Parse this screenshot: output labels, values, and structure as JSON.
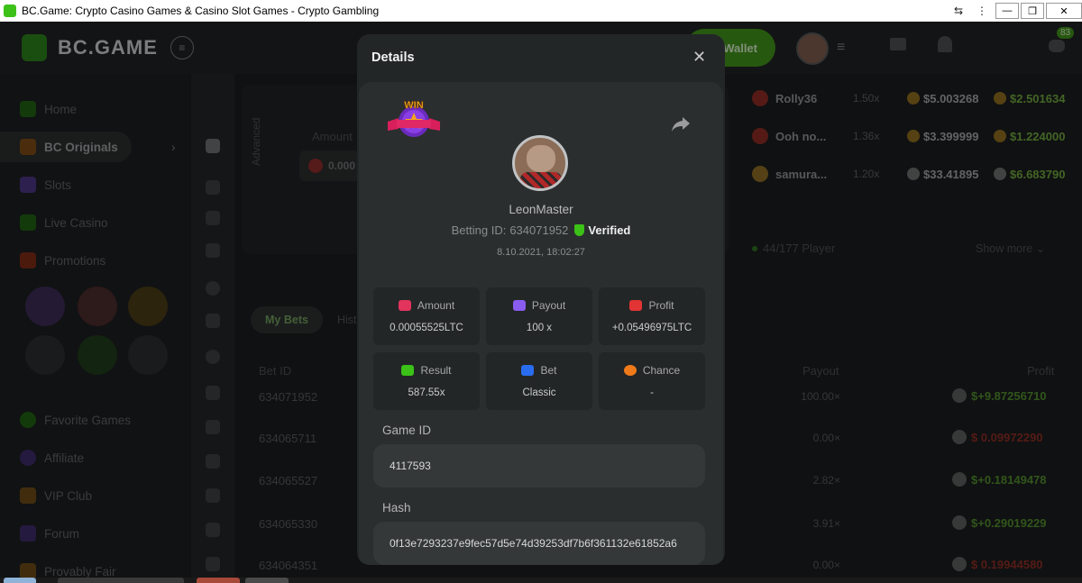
{
  "window": {
    "title": "BC.Game: Crypto Casino Games & Casino Slot Games - Crypto Gambling",
    "minimize": "—",
    "maximize": "❐",
    "close": "✕"
  },
  "header": {
    "logo": "BC.GAME",
    "wallet_label": "Wallet",
    "chat_badge": "83"
  },
  "sidebar": {
    "items": [
      {
        "label": "Home",
        "icon": "home-icon",
        "color": "#3bc117"
      },
      {
        "label": "BC Originals",
        "icon": "originals-icon",
        "color": "#e08a2a"
      },
      {
        "label": "Slots",
        "icon": "slots-icon",
        "color": "#8a5cf0"
      },
      {
        "label": "Live Casino",
        "icon": "live-casino-icon",
        "color": "#3bc117"
      },
      {
        "label": "Promotions",
        "icon": "promotions-icon",
        "color": "#e04a2a"
      },
      {
        "label": "Favorite Games",
        "icon": "star-icon",
        "color": "#3bc117"
      },
      {
        "label": "Affiliate",
        "icon": "affiliate-icon",
        "color": "#8a5cf0"
      },
      {
        "label": "VIP Club",
        "icon": "vip-icon",
        "color": "#e0a02a"
      },
      {
        "label": "Forum",
        "icon": "forum-icon",
        "color": "#8a5cf0"
      },
      {
        "label": "Provably Fair",
        "icon": "provably-fair-icon",
        "color": "#e0a02a"
      }
    ]
  },
  "game": {
    "advanced_label": "Advanced",
    "amount_label": "Amount",
    "amount_value": "0.000"
  },
  "bets": {
    "tabs": [
      "My Bets",
      "Hist"
    ],
    "columns": {
      "bet_id": "Bet ID",
      "payout": "Payout",
      "profit": "Profit"
    },
    "rows": [
      {
        "id": "634071952",
        "payout": "100.00×",
        "profit": "$+9.87256710",
        "positive": true
      },
      {
        "id": "634065711",
        "payout": "0.00×",
        "profit": "$ 0.09972290",
        "positive": false
      },
      {
        "id": "634065527",
        "payout": "2.82×",
        "profit": "$+0.18149478",
        "positive": true
      },
      {
        "id": "634065330",
        "payout": "3.91×",
        "profit": "$+0.29019229",
        "positive": true
      },
      {
        "id": "634064351",
        "payout": "0.00×",
        "profit": "$ 0.19944580",
        "positive": false
      }
    ]
  },
  "high_rollers": {
    "rows": [
      {
        "name": "Rolly36",
        "mult": "1.50x",
        "amount": "$5.003268",
        "profit": "$2.501634"
      },
      {
        "name": "Ooh no...",
        "mult": "1.36x",
        "amount": "$3.399999",
        "profit": "$1.224000"
      },
      {
        "name": "samura...",
        "mult": "1.20x",
        "amount": "$33.41895",
        "profit": "$6.683790"
      }
    ],
    "players": "44/177 Player",
    "show_more": "Show more"
  },
  "modal": {
    "title": "Details",
    "win_badge": "WIN",
    "username": "LeonMaster",
    "betting_id_label": "Betting ID:",
    "betting_id": "634071952",
    "verified": "Verified",
    "timestamp": "8.10.2021, 18:02:27",
    "stats": [
      {
        "label": "Amount",
        "value": "0.00055525LTC",
        "icon": "amount-icon",
        "color": "#e2345d"
      },
      {
        "label": "Payout",
        "value": "100 x",
        "icon": "payout-icon",
        "color": "#8a5cf0"
      },
      {
        "label": "Profit",
        "value": "+0.05496975LTC",
        "icon": "profit-icon",
        "color": "#e23434"
      },
      {
        "label": "Result",
        "value": "587.55x",
        "icon": "result-icon",
        "color": "#3bc117"
      },
      {
        "label": "Bet",
        "value": "Classic",
        "icon": "bet-icon",
        "color": "#2a6cf0"
      },
      {
        "label": "Chance",
        "value": "-",
        "icon": "chance-icon",
        "color": "#f07a1a"
      }
    ],
    "game_id_label": "Game ID",
    "game_id": "4117593",
    "hash_label": "Hash",
    "hash": "0f13e7293237e9fec57d5e74d39253df7b6f361132e61852a6"
  }
}
